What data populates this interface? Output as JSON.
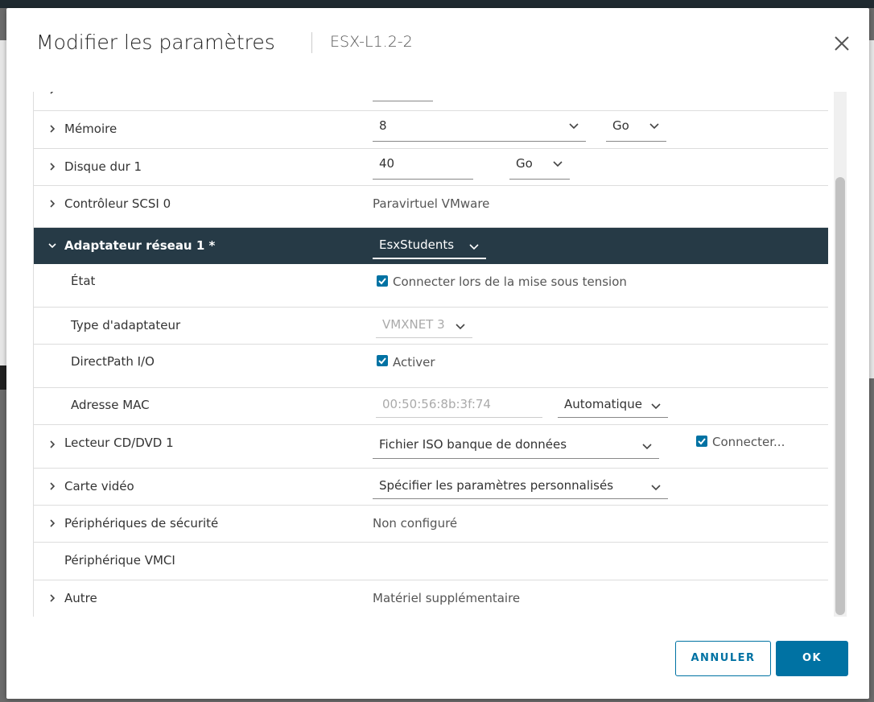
{
  "dialog": {
    "title": "Modifier les paramètres",
    "subtitle": "ESX-L1.2-2"
  },
  "rows": {
    "memoire": {
      "label": "Mémoire",
      "value": "8",
      "unit": "Go"
    },
    "disque": {
      "label": "Disque dur 1",
      "value": "40",
      "unit": "Go"
    },
    "scsi": {
      "label": "Contrôleur SCSI 0",
      "value": "Paravirtuel VMware"
    },
    "adaptateur": {
      "label": "Adaptateur réseau 1 *",
      "value": "EsxStudents"
    },
    "etat": {
      "label": "État",
      "checkbox_label": "Connecter lors de la mise sous tension",
      "checked": true
    },
    "type": {
      "label": "Type d'adaptateur",
      "value": "VMXNET 3"
    },
    "directpath": {
      "label": "DirectPath I/O",
      "checkbox_label": "Activer",
      "checked": true
    },
    "mac": {
      "label": "Adresse MAC",
      "value": "00:50:56:8b:3f:74",
      "mode": "Automatique"
    },
    "cddvd": {
      "label": "Lecteur CD/DVD 1",
      "value": "Fichier ISO banque de données",
      "checkbox_label": "Connecter...",
      "checked": true
    },
    "video": {
      "label": "Carte vidéo",
      "value": "Spécifier les paramètres personnalisés"
    },
    "securite": {
      "label": "Périphériques de sécurité",
      "value": "Non configuré"
    },
    "vmci": {
      "label": "Périphérique VMCI"
    },
    "autre": {
      "label": "Autre",
      "value": "Matériel supplémentaire"
    }
  },
  "buttons": {
    "cancel": "ANNULER",
    "ok": "OK"
  },
  "colors": {
    "accent": "#0072a3",
    "selected_row": "#263a46"
  }
}
